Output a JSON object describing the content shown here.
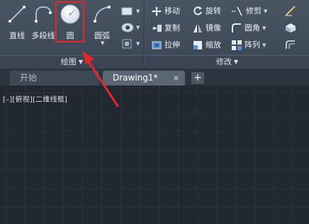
{
  "draw_panel": {
    "tools": {
      "line": "直线",
      "polyline": "多段线",
      "circle": "圆",
      "arc": "圆弧"
    },
    "panel_label": "绘图"
  },
  "modify_panel": {
    "items": {
      "move": "移动",
      "rotate": "旋转",
      "trim": "修剪",
      "copy": "复制",
      "mirror": "镜像",
      "fillet": "圆角",
      "stretch": "拉伸",
      "scale": "缩放",
      "array": "阵列"
    },
    "panel_label": "修改"
  },
  "tabs": {
    "start": "开始",
    "drawing": "Drawing1*",
    "close": "×",
    "add": "+"
  },
  "viewport": {
    "label": "[–][俯视][二维线框]"
  },
  "colors": {
    "highlight_box": "#e8252b",
    "annotation_arrow": "#e8252b",
    "ribbon_bg": "#46505e",
    "canvas_bg": "#212830"
  }
}
